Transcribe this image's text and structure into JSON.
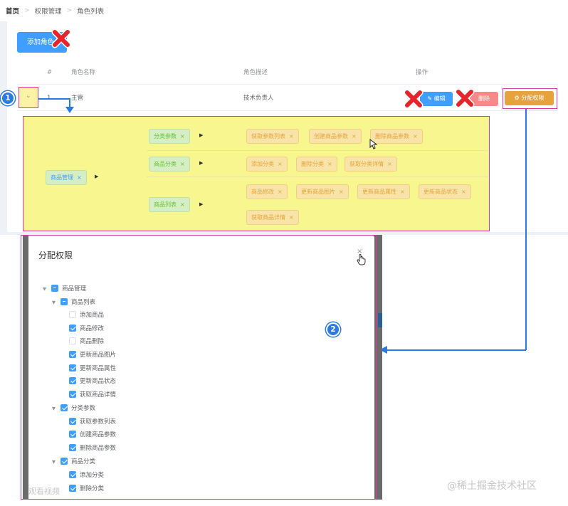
{
  "breadcrumb": {
    "home": "首页",
    "level1": "权限管理",
    "level2": "角色列表",
    "separator": ">"
  },
  "toolbar": {
    "add_role_label": "添加角色"
  },
  "table": {
    "headers": {
      "index": "#",
      "role_name": "角色名称",
      "role_desc": "角色描述",
      "actions": "操作"
    },
    "row": {
      "index": "1",
      "role_name": "主管",
      "role_desc": "技术负责人",
      "edit_label": "编辑",
      "delete_label": "删除",
      "assign_label": "分配权限"
    }
  },
  "annotations": {
    "badge1": "1",
    "badge2": "2",
    "marker_color": "#d63a9a",
    "arrow_color": "#2a7ae2",
    "error_mark": "red-x-icon"
  },
  "expanded_rights": {
    "level1": "商品管理",
    "groups": [
      {
        "level2": "分类参数",
        "level3": [
          "获取参数列表",
          "创建商品参数",
          "删除商品参数"
        ]
      },
      {
        "level2": "商品分类",
        "level3": [
          "添加分类",
          "删除分类",
          "获取分类详情"
        ]
      },
      {
        "level2": "商品列表",
        "level3": [
          "商品修改",
          "更新商品图片",
          "更新商品属性",
          "更新商品状态",
          "获取商品详情"
        ]
      }
    ],
    "tag_close": "×"
  },
  "dialog": {
    "title": "分配权限",
    "close_glyph": "×",
    "tree": [
      {
        "label": "商品管理",
        "state": "half",
        "level": 0
      },
      {
        "label": "商品列表",
        "state": "half",
        "level": 1
      },
      {
        "label": "添加商品",
        "state": "off",
        "level": 2
      },
      {
        "label": "商品修改",
        "state": "on",
        "level": 2
      },
      {
        "label": "商品删除",
        "state": "off",
        "level": 2
      },
      {
        "label": "更新商品图片",
        "state": "on",
        "level": 2
      },
      {
        "label": "更新商品属性",
        "state": "on",
        "level": 2
      },
      {
        "label": "更新商品状态",
        "state": "on",
        "level": 2
      },
      {
        "label": "获取商品详情",
        "state": "on",
        "level": 2
      },
      {
        "label": "分类参数",
        "state": "on",
        "level": 1
      },
      {
        "label": "获取参数列表",
        "state": "on",
        "level": 2
      },
      {
        "label": "创建商品参数",
        "state": "on",
        "level": 2
      },
      {
        "label": "删除商品参数",
        "state": "on",
        "level": 2
      },
      {
        "label": "商品分类",
        "state": "on",
        "level": 1
      },
      {
        "label": "添加分类",
        "state": "on",
        "level": 2
      },
      {
        "label": "删除分类",
        "state": "on",
        "level": 2
      }
    ]
  },
  "watermarks": {
    "left": "观看视频",
    "right": "@稀土掘金技术社区"
  }
}
